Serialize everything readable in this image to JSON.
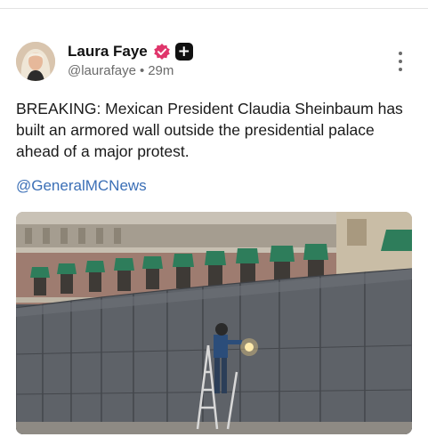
{
  "post": {
    "author": {
      "display_name": "Laura Faye",
      "handle": "@laurafaye",
      "separator": "•",
      "time_ago": "29m",
      "verified_badge_color": "#e0356b",
      "plus_badge_glyph": "+"
    },
    "text": "BREAKING: Mexican President Claudia Sheinbaum has built an armored wall outside the presidential palace ahead of a major protest.",
    "link_text": "@GeneralMCNews",
    "link_color": "#3b6fb6",
    "icons": {
      "verified": "verified-check-icon",
      "plus": "plus-badge-icon",
      "more": "more-vertical-icon"
    }
  }
}
